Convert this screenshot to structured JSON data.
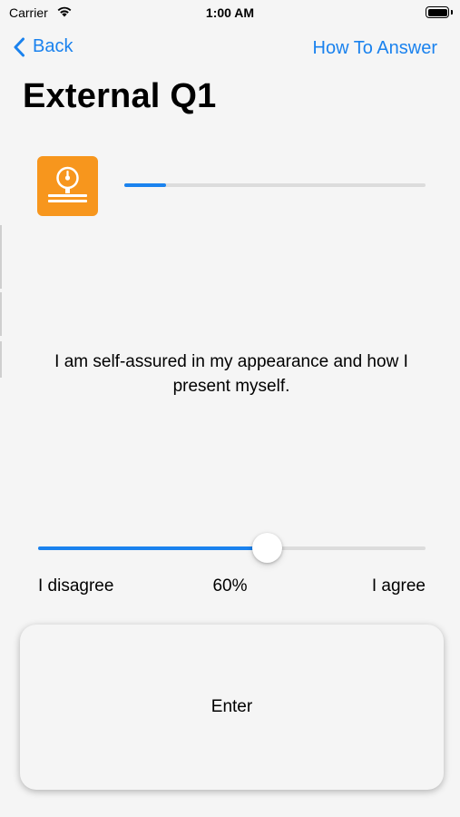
{
  "status_bar": {
    "carrier": "Carrier",
    "time": "1:00 AM"
  },
  "nav": {
    "back_label": "Back",
    "how_to_answer_label": "How To Answer"
  },
  "page": {
    "title": "External Q1",
    "icon": "gauge-app-icon",
    "progress_fraction": 0.14
  },
  "question": {
    "text": "I am self-assured in my appearance and how I present myself."
  },
  "slider": {
    "value_percent": 60,
    "value_label": "60%",
    "min_label": "I disagree",
    "max_label": "I agree"
  },
  "enter_button": {
    "label": "Enter"
  },
  "colors": {
    "accent": "#1a82ee",
    "icon_bg": "#f7961d",
    "background": "#f5f5f5"
  }
}
